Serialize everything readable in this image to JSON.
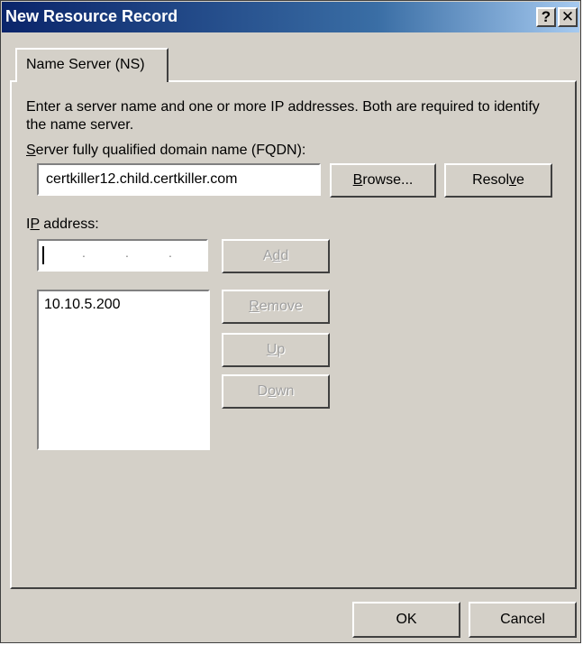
{
  "window": {
    "title": "New Resource Record",
    "help_glyph": "?",
    "close_glyph": "✕"
  },
  "tab": {
    "label": "Name Server (NS)"
  },
  "form": {
    "description": "Enter a server name and one or more IP addresses. Both are required to identify the name server.",
    "fqdn_label_mnemonic": "S",
    "fqdn_label_rest": "erver fully qualified domain name (FQDN):",
    "fqdn_value": "certkiller12.child.certkiller.com",
    "ip_label_first": "I",
    "ip_label_mnemonic": "P",
    "ip_label_rest": " address:",
    "ip_input_separators": [
      ".",
      ".",
      "."
    ],
    "ip_list": [
      "10.10.5.200"
    ]
  },
  "buttons": {
    "browse": {
      "mnemonic": "B",
      "rest": "rowse..."
    },
    "resolve": {
      "before": "Resol",
      "mnemonic": "v",
      "after": "e"
    },
    "add": {
      "before": "A",
      "mnemonic": "d",
      "after": "d"
    },
    "remove": {
      "mnemonic": "R",
      "rest": "emove"
    },
    "up": {
      "mnemonic": "U",
      "rest": "p"
    },
    "down": {
      "before": "D",
      "mnemonic": "o",
      "after": "wn"
    },
    "ok": "OK",
    "cancel": "Cancel"
  },
  "colors": {
    "title_gradient_start": "#0a246a",
    "title_gradient_end": "#a6caf0",
    "dialog_face": "#d4d0c8",
    "disabled_text": "#a0a0a0"
  }
}
